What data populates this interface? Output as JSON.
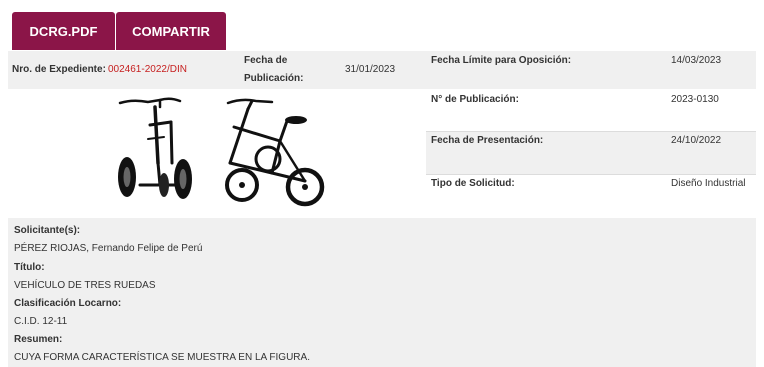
{
  "buttons": {
    "pdf": "DCRG.PDF",
    "share": "COMPARTIR"
  },
  "left": {
    "expediente_label": "Nro. de Expediente:",
    "expediente_value": "002461-2022/DIN",
    "fecha_pub_label_1": "Fecha de",
    "fecha_pub_label_2": "Publicación:",
    "fecha_pub_value": "31/01/2023"
  },
  "right": [
    {
      "label": "Fecha Límite para Oposición:",
      "value": "14/03/2023"
    },
    {
      "label": "N° de Publicación:",
      "value": "2023-0130"
    },
    {
      "label": "Fecha de Presentación:",
      "value": "24/10/2022"
    },
    {
      "label": "Tipo de Solicitud:",
      "value": "Diseño Industrial"
    }
  ],
  "details": {
    "solicitantes_label": "Solicitante(s):",
    "solicitantes_value": "PÉREZ RIOJAS, Fernando Felipe de Perú",
    "titulo_label": "Título:",
    "titulo_value": "VEHÍCULO DE TRES RUEDAS",
    "clasificacion_label": "Clasificación Locarno:",
    "clasificacion_value": "C.I.D. 12-11",
    "resumen_label": "Resumen:",
    "resumen_value": "CUYA FORMA CARACTERÍSTICA SE MUESTRA EN LA FIGURA."
  },
  "images": [
    {
      "icon": "tricycle-front-view-icon"
    },
    {
      "icon": "tricycle-side-view-icon"
    }
  ],
  "colors": {
    "button_bg": "#8b1548",
    "band_bg": "#f0f0f0",
    "accent_red": "#c62020"
  }
}
